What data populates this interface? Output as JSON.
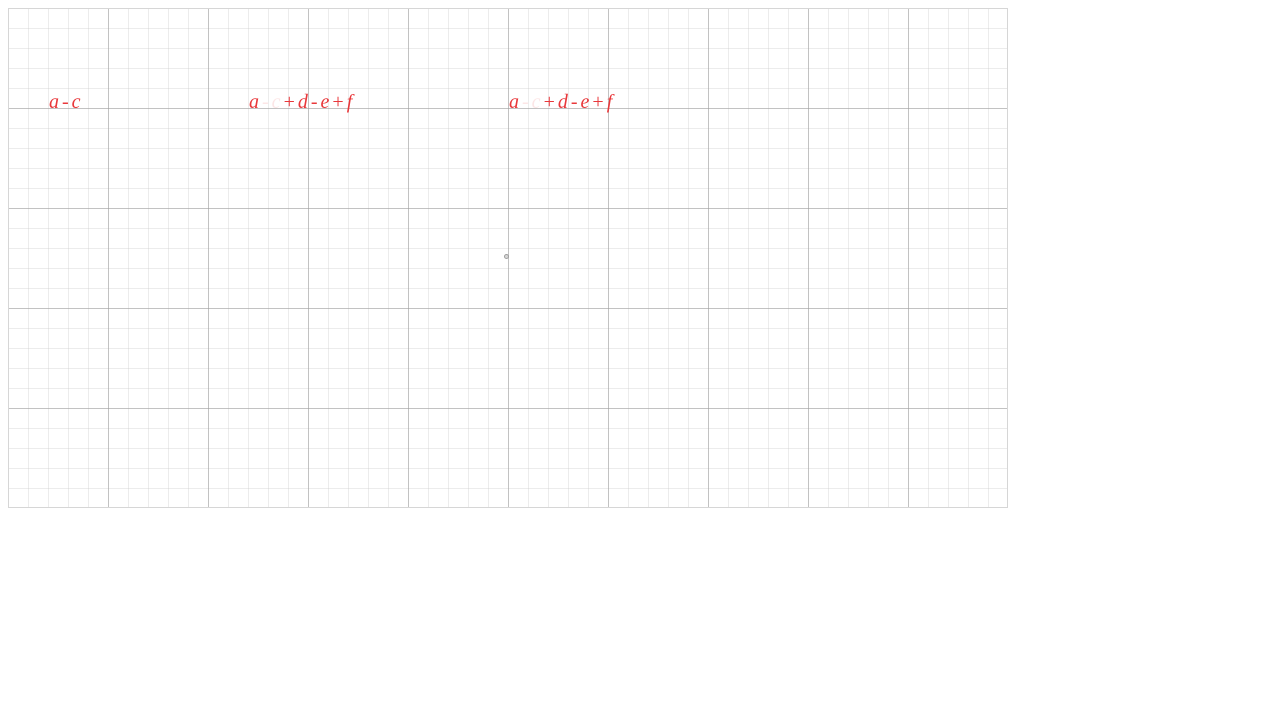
{
  "colors": {
    "expression_red": "#e8383b",
    "grid_major": "#a0a0a0",
    "grid_minor": "#c8c8c8",
    "point": "#9e9e9e"
  },
  "expressions": [
    {
      "tokens": [
        {
          "text": "a",
          "faded": false
        },
        {
          "text": "-",
          "faded": false,
          "op": true
        },
        {
          "text": "c",
          "faded": false
        }
      ]
    },
    {
      "tokens": [
        {
          "text": "a",
          "faded": false
        },
        {
          "text": "-",
          "faded": true,
          "op": true
        },
        {
          "text": "c",
          "faded": true
        },
        {
          "text": "+",
          "faded": false,
          "op": true
        },
        {
          "text": "d",
          "faded": false
        },
        {
          "text": "-",
          "faded": false,
          "op": true
        },
        {
          "text": "e",
          "faded": false
        },
        {
          "text": "+",
          "faded": false,
          "op": true
        },
        {
          "text": "f",
          "faded": false
        }
      ]
    },
    {
      "tokens": [
        {
          "text": "a",
          "faded": false
        },
        {
          "text": "-",
          "faded": true,
          "op": true
        },
        {
          "text": "c",
          "faded": true
        },
        {
          "text": "+",
          "faded": false,
          "op": true
        },
        {
          "text": "d",
          "faded": false
        },
        {
          "text": "-",
          "faded": false,
          "op": true
        },
        {
          "text": "e",
          "faded": false
        },
        {
          "text": "+",
          "faded": false,
          "op": true
        },
        {
          "text": "f",
          "faded": false
        }
      ]
    }
  ]
}
